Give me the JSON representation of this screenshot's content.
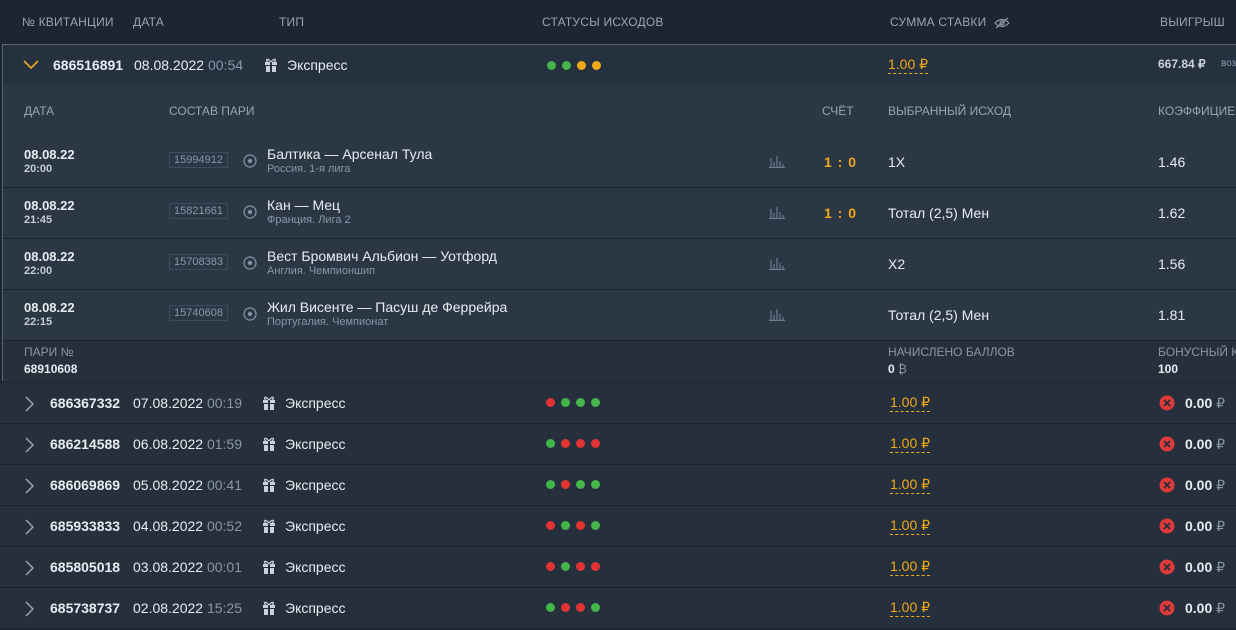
{
  "header": {
    "col_id": "№ КВИТАНЦИИ",
    "col_date": "ДАТА",
    "col_type": "ТИП",
    "col_status": "СТАТУСЫ ИСХОДОВ",
    "col_amount": "СУММА СТАВКИ",
    "col_win": "ВЫИГРЫШ"
  },
  "colors": {
    "green": "#43b549",
    "red": "#e03434",
    "orange": "#f0a918",
    "accent": "#f2a917"
  },
  "expanded": {
    "id": "686516891",
    "date": "08.08.2022",
    "time": "00:54",
    "type": "Экспресс",
    "statuses": [
      "green",
      "green",
      "orange",
      "orange"
    ],
    "amount": "1.00 ₽",
    "win": "667.84 ₽",
    "win_extra": "воз",
    "sub_header": {
      "date": "ДАТА",
      "composition": "СОСТАВ ПАРИ",
      "score": "СЧЁТ",
      "pick": "ВЫБРАННЫЙ ИСХОД",
      "coef": "КОЭФФИЦИЕН"
    },
    "legs": [
      {
        "date": "08.08.22",
        "time": "20:00",
        "event_id": "15994912",
        "event": "Балтика — Арсенал Тула",
        "league": "Россия. 1-я лига",
        "score": "1 : 0",
        "pick": "1X",
        "coef": "1.46"
      },
      {
        "date": "08.08.22",
        "time": "21:45",
        "event_id": "15821661",
        "event": "Кан — Мец",
        "league": "Франция. Лига 2",
        "score": "1 : 0",
        "pick": "Тотал (2,5) Мен",
        "coef": "1.62"
      },
      {
        "date": "08.08.22",
        "time": "22:00",
        "event_id": "15708383",
        "event": "Вест Бромвич Альбион — Уотфорд",
        "league": "Англия. Чемпионшип",
        "score": "",
        "pick": "X2",
        "coef": "1.56"
      },
      {
        "date": "08.08.22",
        "time": "22:15",
        "event_id": "15740608",
        "event": "Жил Висенте — Пасуш де Феррейра",
        "league": "Португалия. Чемпионат",
        "score": "",
        "pick": "Тотал (2,5) Мен",
        "coef": "1.81"
      }
    ],
    "footer": {
      "bet_no_label": "ПАРИ №",
      "bet_no": "68910608",
      "points_label": "НАЧИСЛЕНО БАЛЛОВ",
      "points": "0",
      "bonus_label": "БОНУСНЫЙ К",
      "bonus": "100"
    }
  },
  "rows": [
    {
      "id": "686367332",
      "date": "07.08.2022",
      "time": "00:19",
      "type": "Экспресс",
      "statuses": [
        "red",
        "green",
        "green",
        "green"
      ],
      "amount": "1.00 ₽",
      "win": "0.00",
      "cur": "₽"
    },
    {
      "id": "686214588",
      "date": "06.08.2022",
      "time": "01:59",
      "type": "Экспресс",
      "statuses": [
        "green",
        "red",
        "red",
        "red"
      ],
      "amount": "1.00 ₽",
      "win": "0.00",
      "cur": "₽"
    },
    {
      "id": "686069869",
      "date": "05.08.2022",
      "time": "00:41",
      "type": "Экспресс",
      "statuses": [
        "green",
        "red",
        "green",
        "green"
      ],
      "amount": "1.00 ₽",
      "win": "0.00",
      "cur": "₽"
    },
    {
      "id": "685933833",
      "date": "04.08.2022",
      "time": "00:52",
      "type": "Экспресс",
      "statuses": [
        "red",
        "green",
        "red",
        "green"
      ],
      "amount": "1.00 ₽",
      "win": "0.00",
      "cur": "₽"
    },
    {
      "id": "685805018",
      "date": "03.08.2022",
      "time": "00:01",
      "type": "Экспресс",
      "statuses": [
        "red",
        "green",
        "red",
        "red"
      ],
      "amount": "1.00 ₽",
      "win": "0.00",
      "cur": "₽"
    },
    {
      "id": "685738737",
      "date": "02.08.2022",
      "time": "15:25",
      "type": "Экспресс",
      "statuses": [
        "green",
        "red",
        "red",
        "green"
      ],
      "amount": "1.00 ₽",
      "win": "0.00",
      "cur": "₽"
    }
  ]
}
